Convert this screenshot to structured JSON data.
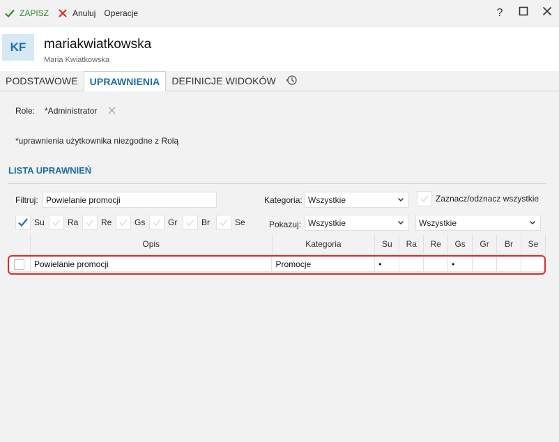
{
  "toolbar": {
    "save_label": "ZAPISZ",
    "cancel_label": "Anuluj",
    "operations_label": "Operacje",
    "help_label": "?"
  },
  "header": {
    "avatar_initials": "KF",
    "username": "mariakwiatkowska",
    "fullname": "Maria Kwiatkowska"
  },
  "tabs": [
    {
      "label": "PODSTAWOWE",
      "active": false
    },
    {
      "label": "UPRAWNIENIA",
      "active": true
    },
    {
      "label": "DEFINICJE WIDOKÓW",
      "active": false
    }
  ],
  "roles": {
    "label": "Role:",
    "value": "*Administrator"
  },
  "note": "*uprawnienia użytkownika niezgodne z Rolą",
  "section_title": "LISTA UPRAWNIEŃ",
  "filters": {
    "filter_label": "Filtruj:",
    "filter_value": "Powielanie promocji",
    "category_label": "Kategoria:",
    "category_value": "Wszystkie",
    "toggle_all_label": "Zaznacz/odznacz wszystkie",
    "show_label": "Pokazuj:",
    "show_value": "Wszystkie",
    "show_value2": "Wszystkie",
    "rights": [
      {
        "label": "Su",
        "checked": true
      },
      {
        "label": "Ra",
        "checked": false
      },
      {
        "label": "Re",
        "checked": false
      },
      {
        "label": "Gs",
        "checked": false
      },
      {
        "label": "Gr",
        "checked": false
      },
      {
        "label": "Br",
        "checked": false
      },
      {
        "label": "Se",
        "checked": false
      }
    ]
  },
  "grid": {
    "columns": [
      "Opis",
      "Kategoria",
      "Su",
      "Ra",
      "Re",
      "Gs",
      "Gr",
      "Br",
      "Se"
    ],
    "rows": [
      {
        "opis": "Powielanie promocji",
        "kategoria": "Promocje",
        "su": "•",
        "ra": "",
        "re": "",
        "gs": "•",
        "gr": "",
        "br": "",
        "se": ""
      }
    ]
  },
  "colors": {
    "accent": "#1c6ea4",
    "save_green": "#2e8b2e",
    "cancel_red": "#e02a2a",
    "highlight": "#e02a2a"
  }
}
